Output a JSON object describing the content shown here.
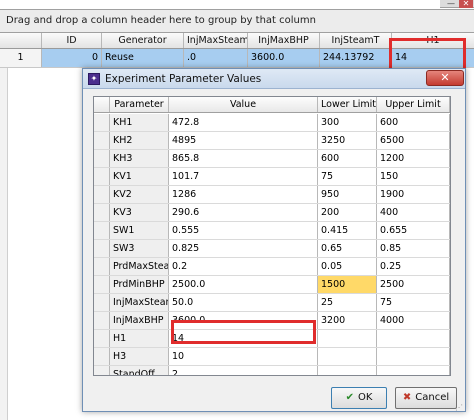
{
  "background": {
    "window_buttons": {
      "minimize": "—",
      "close": "✕"
    },
    "group_panel_text": "Drag and drop a column header here to group by that column",
    "columns": [
      "ID",
      "Generator",
      "InjMaxSteam",
      "InjMaxBHP",
      "InjSteamT",
      "H1"
    ],
    "row": {
      "index": "1",
      "id": "0",
      "generator": "Reuse",
      "injmaxsteam": ".0",
      "injmaxbhp": "3600.0",
      "injsteamt": "244.13792",
      "h1": "14"
    }
  },
  "dialog": {
    "title": "Experiment Parameter Values",
    "icon": "app-icon",
    "close": "✕",
    "columns": {
      "parameter": "Parameter",
      "value": "Value",
      "lower": "Lower Limit",
      "upper": "Upper Limit"
    },
    "rows": [
      {
        "parameter": "KH1",
        "value": "472.8",
        "lower": "300",
        "upper": "600"
      },
      {
        "parameter": "KH2",
        "value": "4895",
        "lower": "3250",
        "upper": "6500"
      },
      {
        "parameter": "KH3",
        "value": "865.8",
        "lower": "600",
        "upper": "1200"
      },
      {
        "parameter": "KV1",
        "value": "101.7",
        "lower": "75",
        "upper": "150"
      },
      {
        "parameter": "KV2",
        "value": "1286",
        "lower": "950",
        "upper": "1900"
      },
      {
        "parameter": "KV3",
        "value": "290.6",
        "lower": "200",
        "upper": "400"
      },
      {
        "parameter": "SW1",
        "value": "0.555",
        "lower": "0.415",
        "upper": "0.655"
      },
      {
        "parameter": "SW3",
        "value": "0.825",
        "lower": "0.65",
        "upper": "0.85"
      },
      {
        "parameter": "PrdMaxSteam",
        "value": "0.2",
        "lower": "0.05",
        "upper": "0.25"
      },
      {
        "parameter": "PrdMinBHP",
        "value": "2500.0",
        "lower": "1500",
        "upper": "2500"
      },
      {
        "parameter": "InjMaxSteam",
        "value": "50.0",
        "lower": "25",
        "upper": "75"
      },
      {
        "parameter": "InjMaxBHP",
        "value": "3600.0",
        "lower": "3200",
        "upper": "4000"
      },
      {
        "parameter": "H1",
        "value": "14",
        "lower": "",
        "upper": ""
      },
      {
        "parameter": "H3",
        "value": "10",
        "lower": "",
        "upper": ""
      },
      {
        "parameter": "StandOff",
        "value": "2",
        "lower": "",
        "upper": ""
      }
    ],
    "buttons": {
      "ok": "OK",
      "ok_icon": "✔",
      "cancel": "Cancel",
      "cancel_icon": "✖"
    }
  },
  "colors": {
    "selection": "#a7cdf0",
    "highlight_cell": "#ffd968",
    "annotation_red": "#e02c2c"
  }
}
